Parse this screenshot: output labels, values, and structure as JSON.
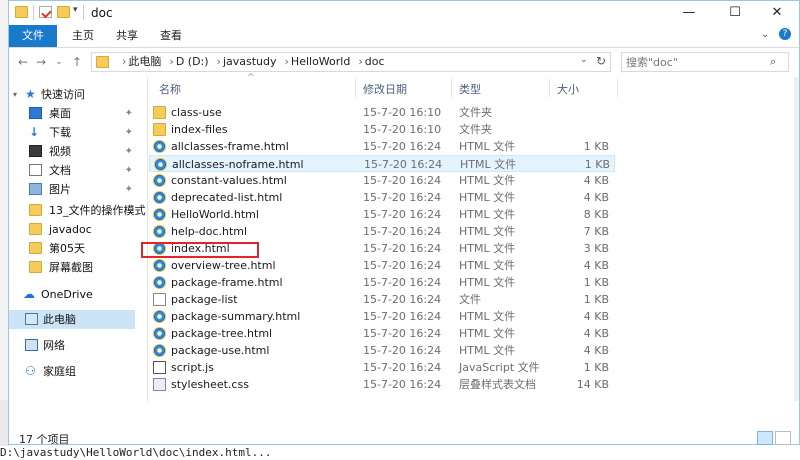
{
  "window": {
    "title": "doc",
    "controls": {
      "minimize": "—",
      "maximize": "☐",
      "close": "✕"
    }
  },
  "ribbon": {
    "tabs": [
      {
        "label": "文件",
        "active": true
      },
      {
        "label": "主页"
      },
      {
        "label": "共享"
      },
      {
        "label": "查看"
      }
    ]
  },
  "address": {
    "crumbs": [
      "此电脑",
      "D (D:)",
      "javastudy",
      "HelloWorld",
      "doc"
    ],
    "search_placeholder": "搜索\"doc\""
  },
  "nav": {
    "quick_access": "快速访问",
    "items": [
      {
        "label": "桌面",
        "pinned": true,
        "icon": "desktop-icon"
      },
      {
        "label": "下载",
        "pinned": true,
        "icon": "download-icon"
      },
      {
        "label": "视频",
        "pinned": true,
        "icon": "video-icon"
      },
      {
        "label": "文档",
        "pinned": true,
        "icon": "document-icon"
      },
      {
        "label": "图片",
        "pinned": true,
        "icon": "picture-icon"
      },
      {
        "label": "13_文件的操作模式",
        "pinned": false,
        "icon": "folder-icon"
      },
      {
        "label": "javadoc",
        "pinned": false,
        "icon": "folder-icon"
      },
      {
        "label": "第05天",
        "pinned": false,
        "icon": "folder-icon"
      },
      {
        "label": "屏幕截图",
        "pinned": false,
        "icon": "folder-icon"
      }
    ],
    "pin_glyph": "✦",
    "onedrive": "OneDrive",
    "thispc": "此电脑",
    "network": "网络",
    "homegroup": "家庭组"
  },
  "columns": {
    "name": "名称",
    "date": "修改日期",
    "type": "类型",
    "size": "大小"
  },
  "files": [
    {
      "name": "class-use",
      "date": "15-7-20 16:10",
      "type": "文件夹",
      "size": "",
      "icon": "folder"
    },
    {
      "name": "index-files",
      "date": "15-7-20 16:10",
      "type": "文件夹",
      "size": "",
      "icon": "folder"
    },
    {
      "name": "allclasses-frame.html",
      "date": "15-7-20 16:24",
      "type": "HTML 文件",
      "size": "1 KB",
      "icon": "ie"
    },
    {
      "name": "allclasses-noframe.html",
      "date": "15-7-20 16:24",
      "type": "HTML 文件",
      "size": "1 KB",
      "icon": "ie",
      "selected": true
    },
    {
      "name": "constant-values.html",
      "date": "15-7-20 16:24",
      "type": "HTML 文件",
      "size": "4 KB",
      "icon": "ie"
    },
    {
      "name": "deprecated-list.html",
      "date": "15-7-20 16:24",
      "type": "HTML 文件",
      "size": "4 KB",
      "icon": "ie"
    },
    {
      "name": "HelloWorld.html",
      "date": "15-7-20 16:24",
      "type": "HTML 文件",
      "size": "8 KB",
      "icon": "ie"
    },
    {
      "name": "help-doc.html",
      "date": "15-7-20 16:24",
      "type": "HTML 文件",
      "size": "7 KB",
      "icon": "ie"
    },
    {
      "name": "index.html",
      "date": "15-7-20 16:24",
      "type": "HTML 文件",
      "size": "3 KB",
      "icon": "ie"
    },
    {
      "name": "overview-tree.html",
      "date": "15-7-20 16:24",
      "type": "HTML 文件",
      "size": "4 KB",
      "icon": "ie"
    },
    {
      "name": "package-frame.html",
      "date": "15-7-20 16:24",
      "type": "HTML 文件",
      "size": "1 KB",
      "icon": "ie"
    },
    {
      "name": "package-list",
      "date": "15-7-20 16:24",
      "type": "文件",
      "size": "1 KB",
      "icon": "doc"
    },
    {
      "name": "package-summary.html",
      "date": "15-7-20 16:24",
      "type": "HTML 文件",
      "size": "4 KB",
      "icon": "ie"
    },
    {
      "name": "package-tree.html",
      "date": "15-7-20 16:24",
      "type": "HTML 文件",
      "size": "4 KB",
      "icon": "ie"
    },
    {
      "name": "package-use.html",
      "date": "15-7-20 16:24",
      "type": "HTML 文件",
      "size": "4 KB",
      "icon": "ie"
    },
    {
      "name": "script.js",
      "date": "15-7-20 16:24",
      "type": "JavaScript 文件",
      "size": "1 KB",
      "icon": "js"
    },
    {
      "name": "stylesheet.css",
      "date": "15-7-20 16:24",
      "type": "层叠样式表文档",
      "size": "14 KB",
      "icon": "css"
    }
  ],
  "status": {
    "item_count": "17 个项目"
  },
  "console": {
    "command": "D:\\javastudy\\HelloWorld\\doc\\index.html..."
  },
  "colors": {
    "accent": "#1979ca",
    "highlight": "#e0262b",
    "selection": "#cce8ff"
  }
}
